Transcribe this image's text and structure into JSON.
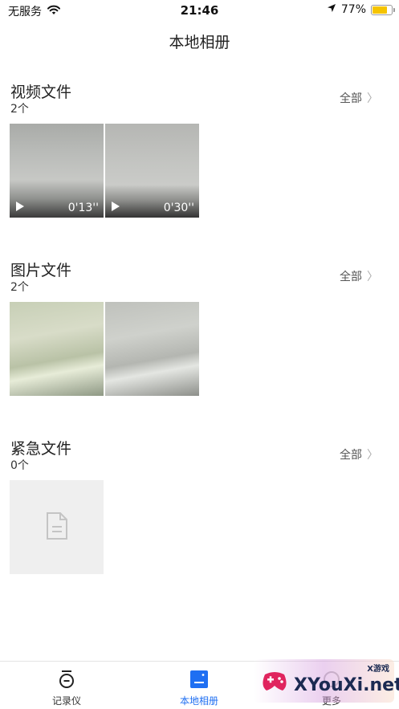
{
  "status_bar": {
    "carrier": "无服务",
    "time": "21:46",
    "battery_percent": "77%",
    "battery_level": 0.77,
    "wifi_icon": "wifi-icon",
    "location_icon": "location-arrow-icon"
  },
  "nav": {
    "title": "本地相册"
  },
  "sections": [
    {
      "title": "视频文件",
      "count": "2个",
      "all_label": "全部",
      "chevron": "〉",
      "items": [
        {
          "kind": "video",
          "duration": "0'13''"
        },
        {
          "kind": "video",
          "duration": "0'30''"
        }
      ]
    },
    {
      "title": "图片文件",
      "count": "2个",
      "all_label": "全部",
      "chevron": "〉",
      "items": [
        {
          "kind": "photo"
        },
        {
          "kind": "photo"
        }
      ]
    },
    {
      "title": "紧急文件",
      "count": "0个",
      "all_label": "全部",
      "chevron": "〉",
      "items": [
        {
          "kind": "placeholder",
          "icon": "document-icon"
        }
      ]
    }
  ],
  "tabbar": {
    "tabs": [
      {
        "label": "记录仪",
        "icon": "dashcam-icon",
        "active": false
      },
      {
        "label": "本地相册",
        "icon": "album-icon",
        "active": true
      },
      {
        "label": "更多",
        "icon": "more-icon",
        "active": false
      }
    ]
  },
  "watermark": {
    "brand": "XYouXi.net",
    "tag": "X游戏"
  },
  "colors": {
    "accent": "#1f6ff2",
    "battery": "#f5c400",
    "placeholder_bg": "#efefef"
  }
}
